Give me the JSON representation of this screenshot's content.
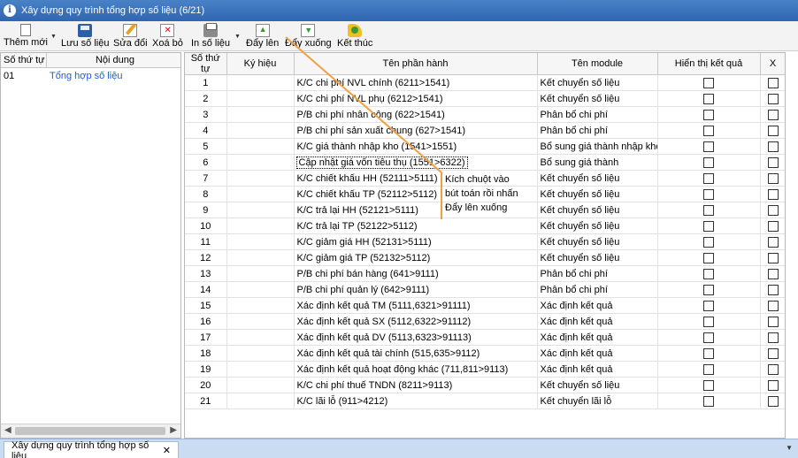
{
  "window": {
    "title": "Xây dựng quy trình tổng hợp số liệu (6/21)"
  },
  "toolbar": {
    "new_label": "Thêm mới",
    "save_label": "Lưu số liệu",
    "edit_label": "Sửa đổi",
    "delete_label": "Xoá bỏ",
    "print_label": "In số liệu",
    "up_label": "Đẩy lên",
    "down_label": "Đẩy xuống",
    "end_label": "Kết thúc"
  },
  "left_panel": {
    "headers": [
      "Số thứ tự",
      "Nội dung"
    ],
    "rows": [
      {
        "stt": "01",
        "content": "Tổng hợp số liệu"
      }
    ]
  },
  "grid": {
    "headers": [
      "Số thứ tự",
      "Ký hiệu",
      "Tên phần hành",
      "Tên module",
      "Hiển thị kết  quả",
      "X"
    ],
    "selected_row": 6,
    "rows": [
      {
        "stt": "1",
        "code": "",
        "name": "K/C chi phí NVL chính (6211>1541)",
        "module": "Kết chuyển số liệu"
      },
      {
        "stt": "2",
        "code": "",
        "name": "K/C chi phí NVL phụ (6212>1541)",
        "module": "Kết chuyển số liệu"
      },
      {
        "stt": "3",
        "code": "",
        "name": "P/B chi phí nhân công (622>1541)",
        "module": "Phân bổ chi phí"
      },
      {
        "stt": "4",
        "code": "",
        "name": "P/B chi phí sản xuất chung (627>1541)",
        "module": "Phân bổ chi phí"
      },
      {
        "stt": "5",
        "code": "",
        "name": "K/C giá thành nhập kho (1541>1551)",
        "module": "Bổ sung giá thành nhập kho"
      },
      {
        "stt": "6",
        "code": "",
        "name": "Cập nhật giá vốn tiêu thụ (1551>6322)",
        "module": "Bổ sung giá thành"
      },
      {
        "stt": "7",
        "code": "",
        "name": "K/C chiết khấu HH (52111>5111)",
        "module": "Kết chuyển số liệu"
      },
      {
        "stt": "8",
        "code": "",
        "name": "K/C chiết khấu TP (52112>5112)",
        "module": "Kết chuyển số liệu"
      },
      {
        "stt": "9",
        "code": "",
        "name": "K/C trả lại HH (52121>5111)",
        "module": "Kết chuyển số liệu"
      },
      {
        "stt": "10",
        "code": "",
        "name": "K/C trả lại TP (52122>5112)",
        "module": "Kết chuyển số liệu"
      },
      {
        "stt": "11",
        "code": "",
        "name": "K/C giảm giá HH (52131>5111)",
        "module": "Kết chuyển số liệu"
      },
      {
        "stt": "12",
        "code": "",
        "name": "K/C giảm giá TP (52132>5112)",
        "module": "Kết chuyển số liệu"
      },
      {
        "stt": "13",
        "code": "",
        "name": "P/B chi phí bán hàng (641>9111)",
        "module": "Phân bổ chi phí"
      },
      {
        "stt": "14",
        "code": "",
        "name": "P/B chi phí quản lý (642>9111)",
        "module": "Phân bổ chi phí"
      },
      {
        "stt": "15",
        "code": "",
        "name": "Xác định kết quả TM (5111,6321>91111)",
        "module": "Xác định kết quả"
      },
      {
        "stt": "16",
        "code": "",
        "name": "Xác định kết quả SX (5112,6322>91112)",
        "module": "Xác định kết quả"
      },
      {
        "stt": "17",
        "code": "",
        "name": "Xác định kết quả DV (5113,6323>91113)",
        "module": "Xác định kết quả"
      },
      {
        "stt": "18",
        "code": "",
        "name": "Xác định kết quả tài chính (515,635>9112)",
        "module": "Xác định kết quả"
      },
      {
        "stt": "19",
        "code": "",
        "name": "Xác định kết quả hoạt động khác (711,811>9113)",
        "module": "Xác định kết quả"
      },
      {
        "stt": "20",
        "code": "",
        "name": "K/C chi phí thuế TNDN (8211>9113)",
        "module": "Kết chuyển số liệu"
      },
      {
        "stt": "21",
        "code": "",
        "name": "K/C lãi lỗ (911>4212)",
        "module": "Kết chuyển lãi lỗ"
      }
    ]
  },
  "annotation": {
    "lines": [
      "Kích chuột vào",
      "bút toán rồi nhấn",
      "Đẩy lên xuống"
    ],
    "color": "#f0a040"
  },
  "bottom_tab": {
    "label": "Xây dựng quy trình tổng hợp số liệu",
    "close": "✕"
  }
}
